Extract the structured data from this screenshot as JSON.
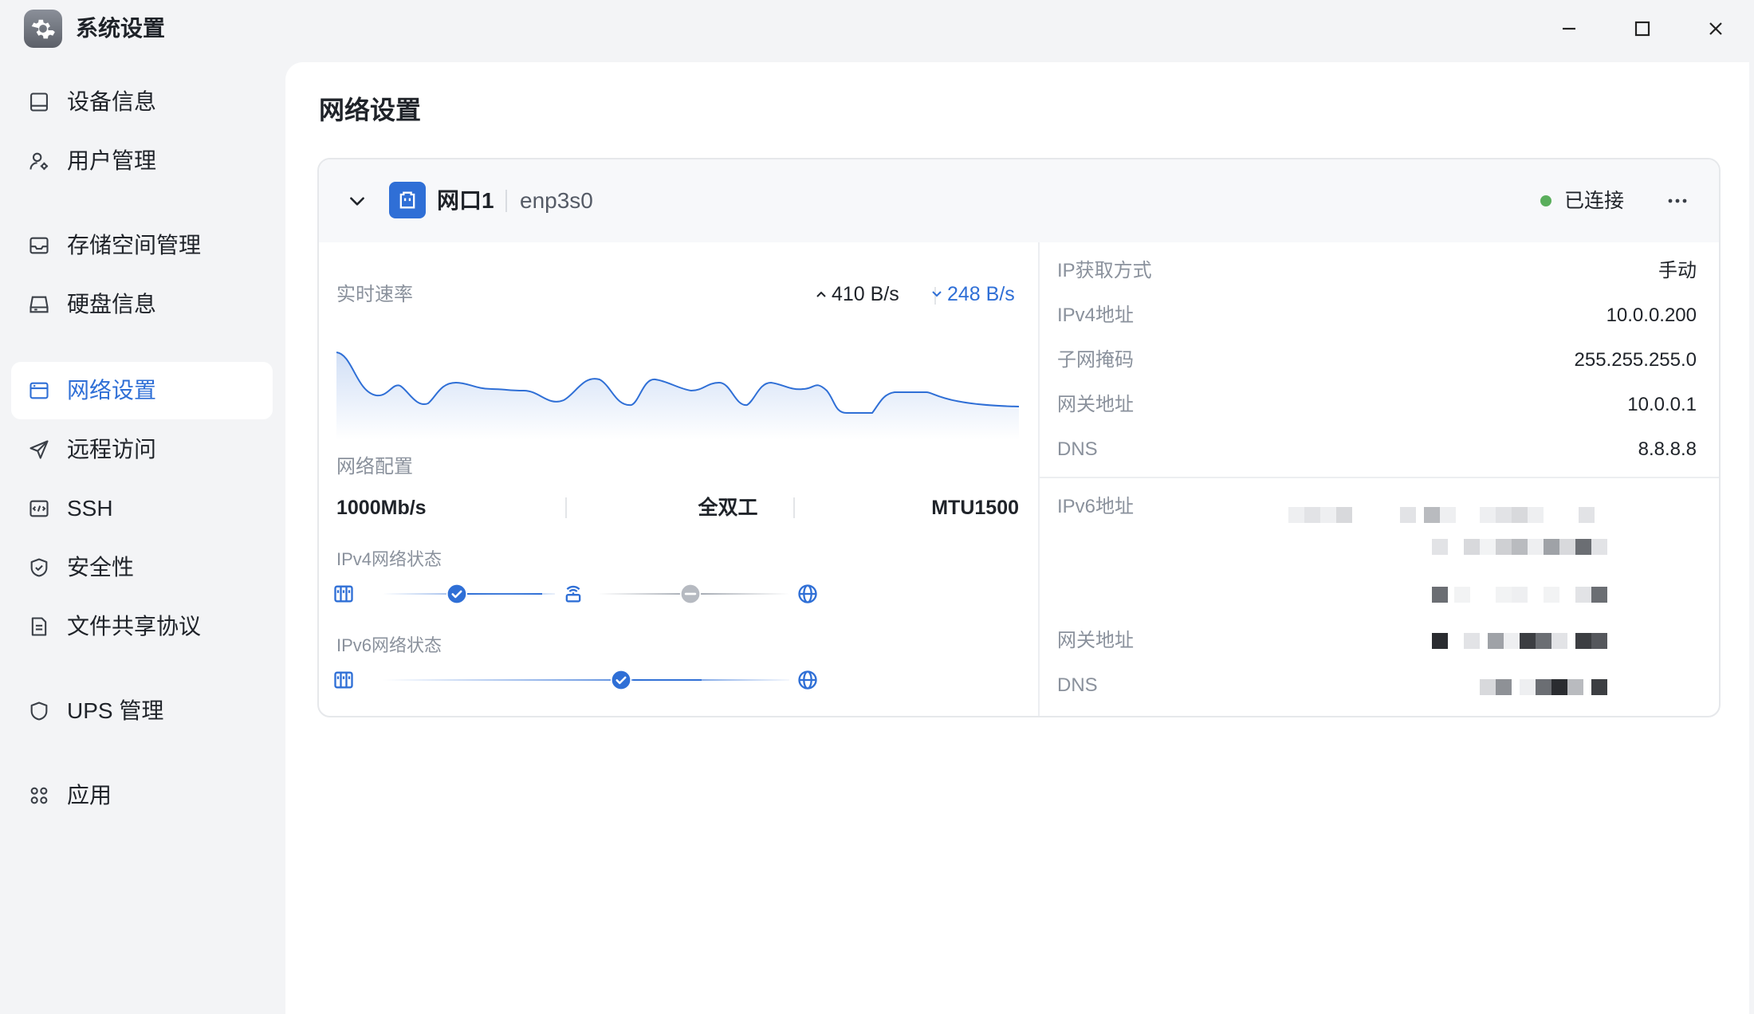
{
  "window": {
    "title": "系统设置",
    "controls": {
      "minimize": "minimize",
      "maximize": "maximize",
      "close": "close"
    }
  },
  "sidebar": {
    "items": [
      {
        "label": "设备信息",
        "icon": "device-info-icon",
        "active": false
      },
      {
        "label": "用户管理",
        "icon": "user-icon",
        "active": false
      },
      {
        "label": "存储空间管理",
        "icon": "storage-icon",
        "active": false
      },
      {
        "label": "硬盘信息",
        "icon": "disk-icon",
        "active": false
      },
      {
        "label": "网络设置",
        "icon": "network-icon",
        "active": true
      },
      {
        "label": "远程访问",
        "icon": "send-icon",
        "active": false
      },
      {
        "label": "SSH",
        "icon": "terminal-icon",
        "active": false
      },
      {
        "label": "安全性",
        "icon": "shield-check-icon",
        "active": false
      },
      {
        "label": "文件共享协议",
        "icon": "file-icon",
        "active": false
      },
      {
        "label": "UPS 管理",
        "icon": "shield-icon",
        "active": false
      },
      {
        "label": "应用",
        "icon": "apps-icon",
        "active": false
      }
    ]
  },
  "main": {
    "title": "网络设置",
    "port": {
      "name": "网口1",
      "device": "enp3s0",
      "status": "已连接",
      "status_color": "#5aae5c",
      "realtime": {
        "label": "实时速率",
        "upload": "410 B/s",
        "download": "248 B/s"
      },
      "config": {
        "label": "网络配置",
        "speed": "1000Mb/s",
        "duplex": "全双工",
        "mtu": "MTU1500"
      },
      "ipv4_status": {
        "label": "IPv4网络状态"
      },
      "ipv6_status": {
        "label": "IPv6网络状态"
      },
      "ipv4": {
        "method_label": "IP获取方式",
        "method": "手动",
        "address_label": "IPv4地址",
        "address": "10.0.0.200",
        "mask_label": "子网掩码",
        "mask": "255.255.255.0",
        "gateway_label": "网关地址",
        "gateway": "10.0.0.1",
        "dns_label": "DNS",
        "dns": "8.8.8.8"
      },
      "ipv6": {
        "address_label": "IPv6地址",
        "gateway_label": "网关地址",
        "dns_label": "DNS"
      }
    }
  },
  "colors": {
    "accent": "#2f6fd6",
    "sidebar_bg": "#f3f4f6",
    "card_header_bg": "#f7f8fa"
  }
}
